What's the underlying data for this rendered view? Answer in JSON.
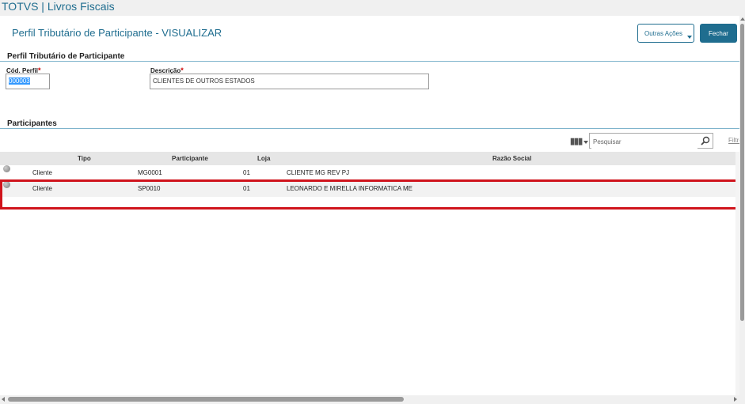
{
  "app": {
    "title": "TOTVS | Livros Fiscais"
  },
  "header": {
    "page_title": "Perfil Tributário de Participante - VISUALIZAR",
    "outras_acoes_label": "Outras Ações",
    "fechar_label": "Fechar"
  },
  "perfil_section": {
    "title": "Perfil Tributário de Participante",
    "cod_label": "Cód. Perfil",
    "cod_value": "000003",
    "descricao_label": "Descrição",
    "descricao_value": "CLIENTES DE OUTROS ESTADOS",
    "required_mark": "*"
  },
  "participantes_section": {
    "title": "Participantes",
    "search_placeholder": "Pesquisar",
    "filtro_label": "Filtro",
    "columns": [
      "Tipo",
      "Participante",
      "Loja",
      "Razão Social"
    ],
    "rows": [
      {
        "tipo": "Cliente",
        "participante": "MG0001",
        "loja": "01",
        "razao_social": "CLIENTE MG REV PJ"
      },
      {
        "tipo": "Cliente",
        "participante": "SP0010",
        "loja": "01",
        "razao_social": "LEONARDO E MIRELLA INFORMATICA ME"
      }
    ]
  },
  "icons": {
    "search": "search-icon",
    "columns": "columns-icon",
    "status": "status-icon"
  },
  "colors": {
    "accent": "#1f6d8f",
    "highlight_border": "#d0141c",
    "required": "#cc0000"
  }
}
